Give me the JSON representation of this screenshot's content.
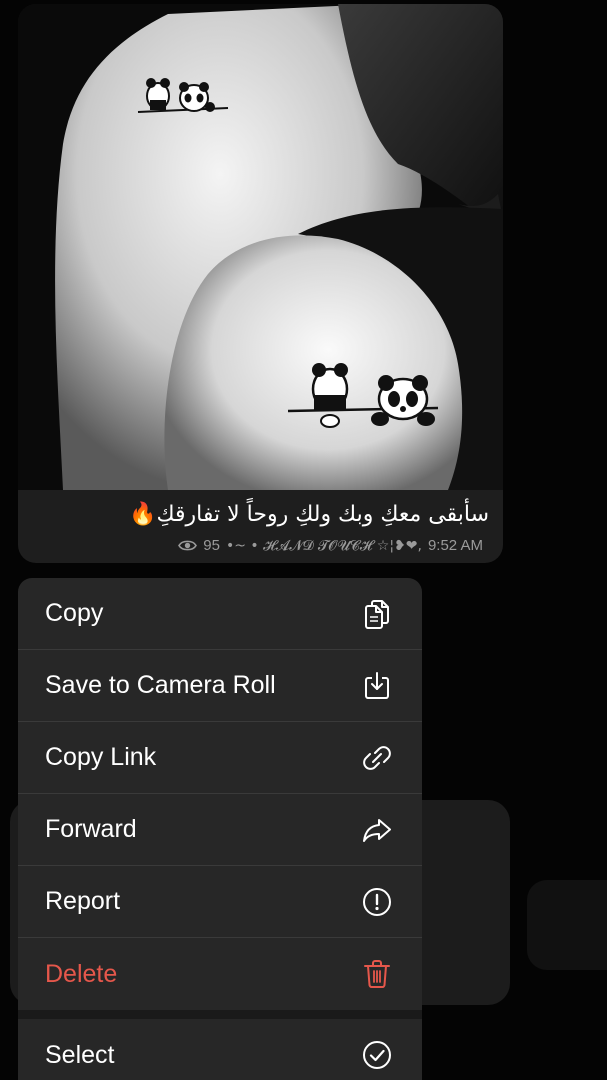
{
  "message": {
    "caption": "سأبقى معكِ وبك ولكِ روحاً لا تفارقكِ🔥",
    "views": "95",
    "author_signature": "•~ • 𝓗𝓐𝓝𝓓 𝓣𝓞𝓤𝓒𝓗 ☆¦❥❤,",
    "time": "9:52 AM",
    "photo_icon": "photo-two-people-panda-tattoos"
  },
  "menu": {
    "items": [
      {
        "label": "Copy",
        "icon": "copy-icon"
      },
      {
        "label": "Save to Camera Roll",
        "icon": "save-download-icon"
      },
      {
        "label": "Copy Link",
        "icon": "link-icon"
      },
      {
        "label": "Forward",
        "icon": "forward-arrow-icon"
      },
      {
        "label": "Report",
        "icon": "exclamation-circle-icon"
      },
      {
        "label": "Delete",
        "icon": "trash-icon"
      },
      {
        "label": "Select",
        "icon": "checkmark-circle-icon"
      }
    ]
  },
  "colors": {
    "menu_background": "#272727",
    "danger": "#e5574b",
    "meta_text": "#9a9a9a"
  }
}
